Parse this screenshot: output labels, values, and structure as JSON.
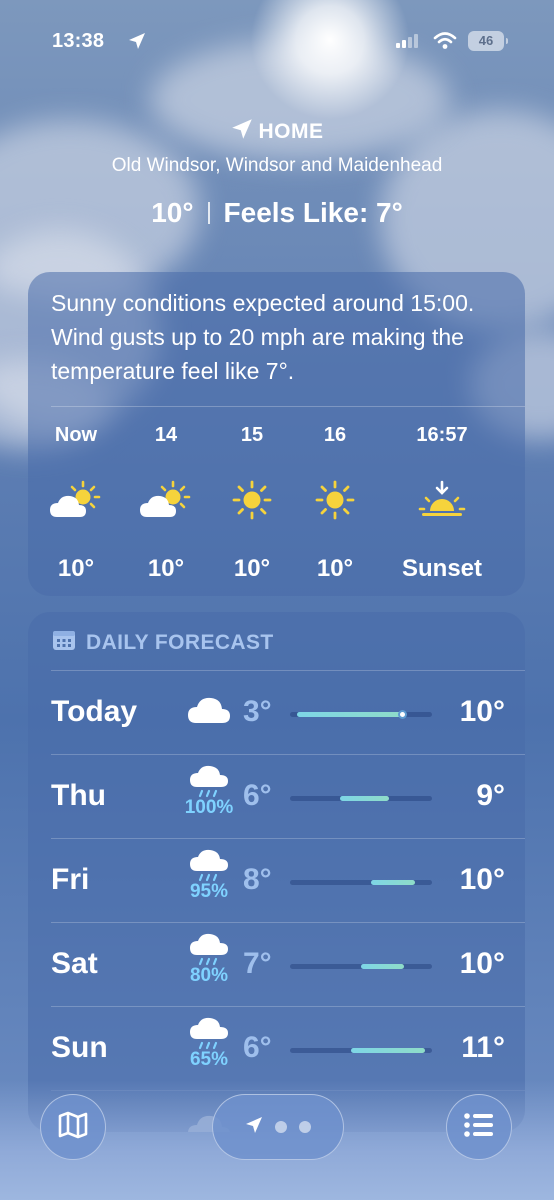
{
  "status_bar": {
    "time": "13:38",
    "battery": "46"
  },
  "header": {
    "home_label": "HOME",
    "location": "Old Windsor, Windsor and Maidenhead",
    "temperature": "10°",
    "feels_like": "Feels Like: 7°"
  },
  "summary": "Sunny conditions expected around 15:00. Wind gusts up to 20 mph are making the temperature feel like 7°.",
  "hourly": [
    {
      "label": "Now",
      "icon": "partly-sunny-icon",
      "temp": "10°"
    },
    {
      "label": "14",
      "icon": "partly-sunny-icon",
      "temp": "10°"
    },
    {
      "label": "15",
      "icon": "sun-icon",
      "temp": "10°"
    },
    {
      "label": "16",
      "icon": "sun-icon",
      "temp": "10°"
    },
    {
      "label": "16:57",
      "icon": "sunset-icon",
      "temp": "Sunset"
    }
  ],
  "daily": {
    "title": "DAILY FORECAST",
    "days": [
      {
        "name": "Today",
        "icon": "cloud-icon",
        "precip": "",
        "low": "3°",
        "high": "10°",
        "range": [
          0.05,
          0.82
        ],
        "current": 0.79
      },
      {
        "name": "Thu",
        "icon": "rain-cloud-icon",
        "precip": "100%",
        "low": "6°",
        "high": "9°",
        "range": [
          0.35,
          0.7
        ]
      },
      {
        "name": "Fri",
        "icon": "rain-cloud-icon",
        "precip": "95%",
        "low": "8°",
        "high": "10°",
        "range": [
          0.57,
          0.88
        ]
      },
      {
        "name": "Sat",
        "icon": "rain-cloud-icon",
        "precip": "80%",
        "low": "7°",
        "high": "10°",
        "range": [
          0.5,
          0.8
        ]
      },
      {
        "name": "Sun",
        "icon": "rain-cloud-icon",
        "precip": "65%",
        "low": "6°",
        "high": "11°",
        "range": [
          0.43,
          0.95
        ]
      }
    ]
  },
  "colors": {
    "accent": "#a8c4ee",
    "precip": "#7fd2ff",
    "sun": "#f6d33c"
  }
}
